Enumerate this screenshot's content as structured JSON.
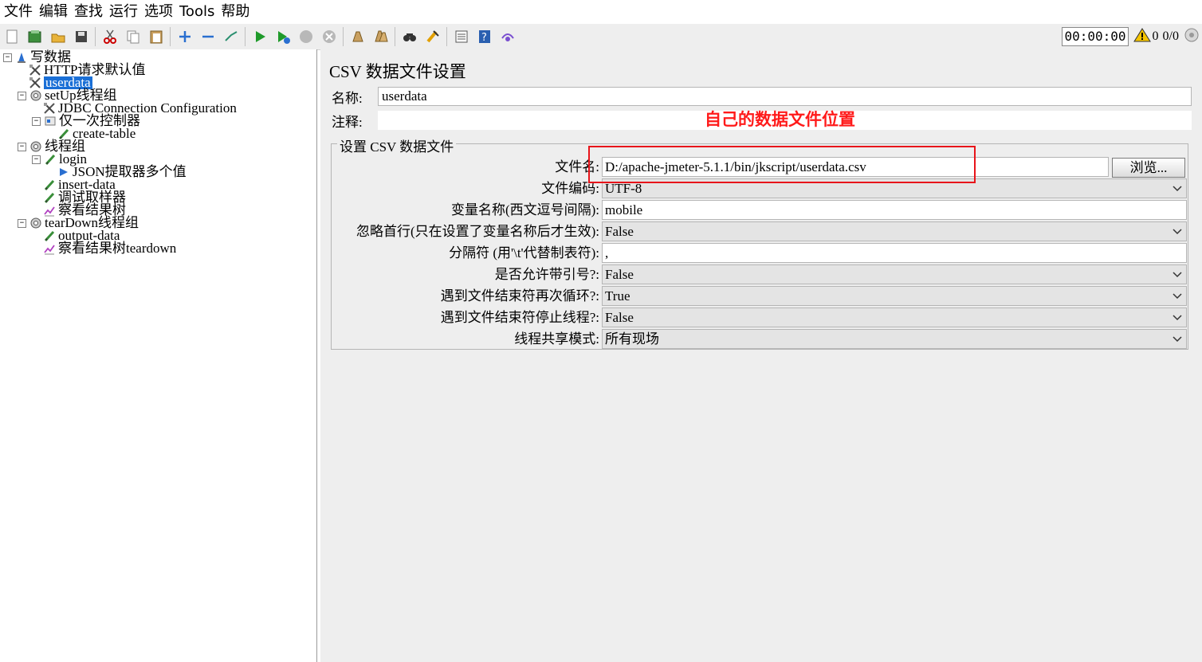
{
  "menu": {
    "items": [
      "文件",
      "编辑",
      "查找",
      "运行",
      "选项",
      "Tools",
      "帮助"
    ]
  },
  "toolbar": {
    "icons": [
      "new-icon",
      "templates-icon",
      "open-icon",
      "save-icon",
      "cut-icon",
      "copy-icon",
      "paste-icon",
      "expand-icon",
      "collapse-icon",
      "toggle-icon",
      "start-icon",
      "start-no-pause-icon",
      "stop-icon",
      "shutdown-icon",
      "clear-icon",
      "clear-all-icon",
      "search-icon",
      "reset-search-icon",
      "function-helper-icon",
      "help-icon",
      "remote-icon"
    ],
    "timer": "00:00:00",
    "warnings": "0",
    "threads": "0/0"
  },
  "tree": {
    "items": [
      {
        "label": "写数据",
        "icon": "testplan-icon",
        "level": 0,
        "toggle": "−"
      },
      {
        "label": "HTTP请求默认值",
        "icon": "config-icon",
        "level": 1
      },
      {
        "label": "userdata",
        "icon": "config-icon",
        "level": 1,
        "selected": true
      },
      {
        "label": "setUp线程组",
        "icon": "gear-icon",
        "level": 1,
        "toggle": "−"
      },
      {
        "label": "JDBC Connection Configuration",
        "icon": "config-icon",
        "level": 2
      },
      {
        "label": "仅一次控制器",
        "icon": "controller-icon",
        "level": 2,
        "toggle": "−"
      },
      {
        "label": "create-table",
        "icon": "sampler-icon",
        "level": 3
      },
      {
        "label": "线程组",
        "icon": "gear-icon",
        "level": 1,
        "toggle": "−"
      },
      {
        "label": "login",
        "icon": "sampler-icon",
        "level": 2,
        "toggle": "−"
      },
      {
        "label": "JSON提取器多个值",
        "icon": "extractor-icon",
        "level": 3
      },
      {
        "label": "insert-data",
        "icon": "sampler-icon",
        "level": 2
      },
      {
        "label": "调试取样器",
        "icon": "sampler-icon",
        "level": 2
      },
      {
        "label": "察看结果树",
        "icon": "listener-icon",
        "level": 2
      },
      {
        "label": "tearDown线程组",
        "icon": "gear-icon",
        "level": 1,
        "toggle": "−"
      },
      {
        "label": "output-data",
        "icon": "sampler-icon",
        "level": 2
      },
      {
        "label": "察看结果树teardown",
        "icon": "listener-icon",
        "level": 2
      }
    ]
  },
  "panel": {
    "title": "CSV 数据文件设置",
    "name_label": "名称:",
    "name_value": "userdata",
    "comment_label": "注释:",
    "comment_value": "",
    "annotation": "自己的数据文件位置",
    "group_title": "设置 CSV 数据文件",
    "browse_label": "浏览...",
    "properties": [
      {
        "label": "文件名:",
        "value": "D:/apache-jmeter-5.1.1/bin/jkscript/userdata.csv",
        "type": "text"
      },
      {
        "label": "文件编码:",
        "value": "UTF-8",
        "type": "select"
      },
      {
        "label": "变量名称(西文逗号间隔):",
        "value": "mobile",
        "type": "text"
      },
      {
        "label": "忽略首行(只在设置了变量名称后才生效):",
        "value": "False",
        "type": "select"
      },
      {
        "label": "分隔符 (用'\\t'代替制表符):",
        "value": ",",
        "type": "text"
      },
      {
        "label": "是否允许带引号?:",
        "value": "False",
        "type": "select"
      },
      {
        "label": "遇到文件结束符再次循环?:",
        "value": "True",
        "type": "select"
      },
      {
        "label": "遇到文件结束符停止线程?:",
        "value": "False",
        "type": "select"
      },
      {
        "label": "线程共享模式:",
        "value": "所有现场",
        "type": "select"
      }
    ]
  },
  "colors": {
    "selection": "#1a6fd6",
    "annotation": "#ff1a1a",
    "highlight_box": "#e8141a",
    "panel_bg": "#eeeeee"
  }
}
